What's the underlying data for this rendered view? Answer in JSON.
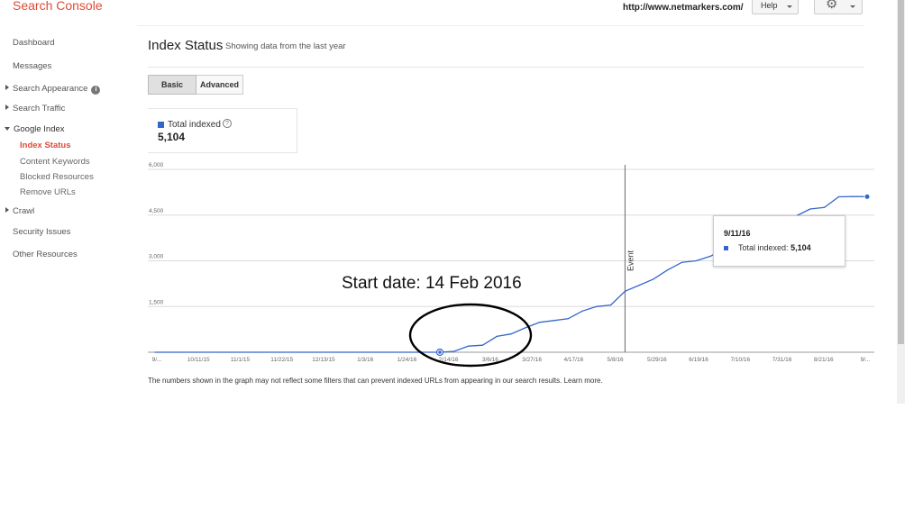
{
  "app": {
    "title": "Search Console"
  },
  "header": {
    "site_url": "http://www.netmarkers.com/",
    "help_label": "Help"
  },
  "sidebar": {
    "items": [
      {
        "label": "Dashboard"
      },
      {
        "label": "Messages"
      },
      {
        "label": "Search Appearance"
      },
      {
        "label": "Search Traffic"
      },
      {
        "label": "Google Index"
      },
      {
        "label": "Index Status"
      },
      {
        "label": "Content Keywords"
      },
      {
        "label": "Blocked Resources"
      },
      {
        "label": "Remove URLs"
      },
      {
        "label": "Crawl"
      },
      {
        "label": "Security Issues"
      },
      {
        "label": "Other Resources"
      }
    ],
    "active": "Index Status"
  },
  "page": {
    "title": "Index Status",
    "subtitle": "Showing data from the last year",
    "tabs": [
      {
        "label": "Basic"
      },
      {
        "label": "Advanced"
      }
    ],
    "selected_tab": "Basic"
  },
  "metric": {
    "label": "Total indexed",
    "value": "5,104",
    "color": "#3366cc"
  },
  "tooltip": {
    "date": "9/11/16",
    "label": "Total indexed:",
    "value": "5,104"
  },
  "annotation": {
    "text": "Start date: 14 Feb 2016"
  },
  "footnote": {
    "text": "The numbers shown in the graph may not reflect some filters that can prevent indexed URLs from appearing in our search results. Learn more."
  },
  "chart_data": {
    "type": "line",
    "series": [
      {
        "name": "Total indexed",
        "color": "#3366cc",
        "x": [
          "9/27/15",
          "2/14/16",
          "2/21/16",
          "2/28/16",
          "3/6/16",
          "3/13/16",
          "3/20/16",
          "3/27/16",
          "4/3/16",
          "4/10/16",
          "4/17/16",
          "4/24/16",
          "5/1/16",
          "5/8/16",
          "5/15/16",
          "5/22/16",
          "5/29/16",
          "6/5/16",
          "6/12/16",
          "6/19/16",
          "6/26/16",
          "7/3/16",
          "7/10/16",
          "7/17/16",
          "7/24/16",
          "7/31/16",
          "8/7/16",
          "8/14/16",
          "8/21/16",
          "8/28/16",
          "9/4/16",
          "9/11/16"
        ],
        "values": [
          0,
          0,
          30,
          200,
          230,
          520,
          600,
          800,
          980,
          1040,
          1100,
          1350,
          1500,
          1550,
          2000,
          2200,
          2400,
          2700,
          2950,
          3000,
          3150,
          3400,
          3600,
          3850,
          4100,
          4450,
          4470,
          4700,
          4750,
          5100,
          5110,
          5104
        ]
      }
    ],
    "x_ticks": [
      "9/...",
      "10/11/15",
      "11/1/15",
      "11/22/15",
      "12/13/15",
      "1/3/16",
      "1/24/16",
      "2/14/16",
      "3/6/16",
      "3/27/16",
      "4/17/16",
      "5/8/16",
      "5/29/16",
      "6/19/16",
      "7/10/16",
      "7/31/16",
      "8/21/16",
      "9/..."
    ],
    "y_ticks": [
      "1,500",
      "3,000",
      "4,500",
      "6,000"
    ],
    "ylim": [
      0,
      6000
    ],
    "grid": true,
    "event": {
      "label": "Event",
      "x": "5/15/16"
    },
    "highlight_point": {
      "x": "2/14/16",
      "y": 0
    }
  }
}
